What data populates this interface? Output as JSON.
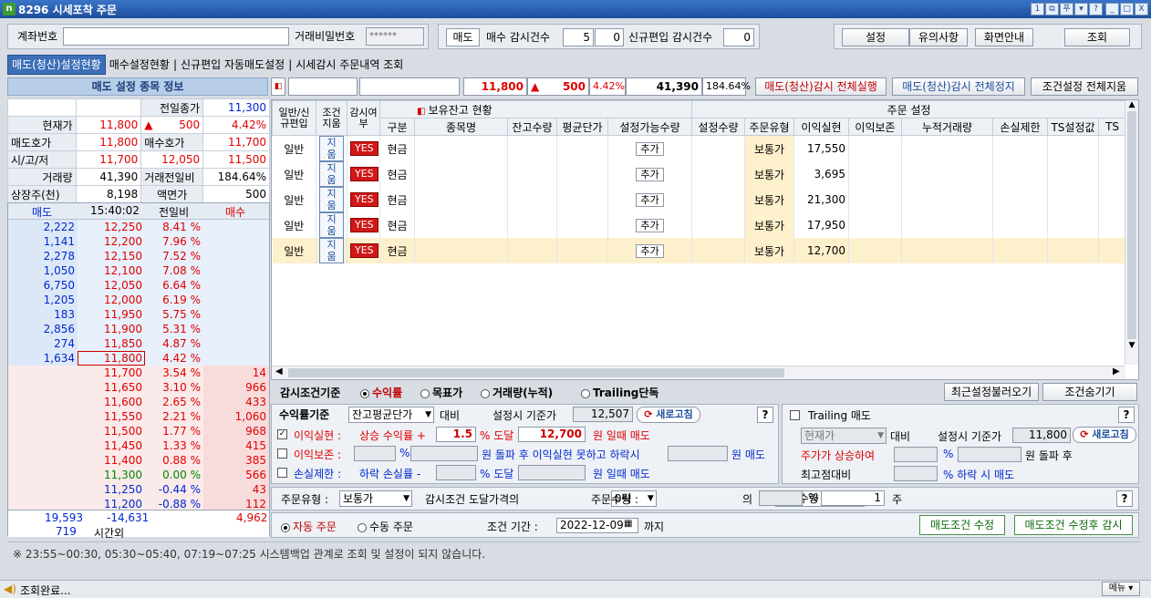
{
  "window": {
    "title": "8296 시세포착 주문",
    "logo": "n",
    "buttons": [
      "1",
      "⧉",
      "푸",
      "▾",
      "?",
      "_",
      "□",
      "X"
    ]
  },
  "top": {
    "account_label": "계좌번호",
    "password_label": "거래비밀번호",
    "password_value": "******",
    "sell_label": "매도",
    "buy_watch_label": "매수 감시건수",
    "buy_watch_a": "5",
    "buy_watch_b": "0",
    "new_watch_label": "신규편입 감시건수",
    "new_watch_val": "0",
    "btn_settings": "설정",
    "btn_notice": "유의사항",
    "btn_guide": "화면안내",
    "btn_query": "조회"
  },
  "tabs": [
    "매도(청산)설정현황",
    "매수설정현황",
    "신규편입 자동매도설정",
    "시세감시 주문내역 조회"
  ],
  "info": {
    "header": "매도 설정 종목 정보",
    "prev_close_label": "전일종가",
    "prev_close": "11,300",
    "cur_label": "현재가",
    "cur": "11,800",
    "chg_sym": "▲",
    "chg": "500",
    "chg_pct": "4.42%",
    "ask_label": "매도호가",
    "ask": "11,800",
    "bid_label": "매수호가",
    "bid": "11,700",
    "ohl_label": "시/고/저",
    "open": "11,700",
    "high": "12,050",
    "low": "11,500",
    "vol_label": "거래량",
    "vol": "41,390",
    "volr_label": "거래전일비",
    "volr": "184.64%",
    "shares_label": "상장주(천)",
    "shares": "8,198",
    "par_label": "액면가",
    "par": "500"
  },
  "hoga": {
    "h_sell": "매도",
    "time": "15:40:02",
    "h_prev": "전일비",
    "h_buy": "매수",
    "asks": [
      [
        "2,222",
        "12,250",
        "8.41 %"
      ],
      [
        "1,141",
        "12,200",
        "7.96 %"
      ],
      [
        "2,278",
        "12,150",
        "7.52 %"
      ],
      [
        "1,050",
        "12,100",
        "7.08 %"
      ],
      [
        "6,750",
        "12,050",
        "6.64 %"
      ],
      [
        "1,205",
        "12,000",
        "6.19 %"
      ],
      [
        "183",
        "11,950",
        "5.75 %"
      ],
      [
        "2,856",
        "11,900",
        "5.31 %"
      ],
      [
        "274",
        "11,850",
        "4.87 %"
      ],
      [
        "1,634",
        "11,800",
        "4.42 %"
      ]
    ],
    "bids": [
      [
        "11,700",
        "3.54 %",
        "14"
      ],
      [
        "11,650",
        "3.10 %",
        "966"
      ],
      [
        "11,600",
        "2.65 %",
        "433"
      ],
      [
        "11,550",
        "2.21 %",
        "1,060"
      ],
      [
        "11,500",
        "1.77 %",
        "968"
      ],
      [
        "11,450",
        "1.33 %",
        "415"
      ],
      [
        "11,400",
        "0.88 %",
        "385"
      ],
      [
        "11,300",
        "0.00 %",
        "566"
      ],
      [
        "11,250",
        "-0.44 %",
        "43"
      ],
      [
        "11,200",
        "-0.88 %",
        "112"
      ]
    ],
    "sum_sell": "19,593",
    "sum_diff": "-14,631",
    "sum_buy": "4,962",
    "after_qty": "719",
    "after_label": "시간외"
  },
  "quote": {
    "price": "11,800",
    "sym": "▲",
    "chg": "500",
    "pct": "4.42%",
    "vol": "41,390",
    "volr": "184.64%",
    "btn_exec": "매도(청산)감시 전체실행",
    "btn_stop": "매도(청산)감시 전체정지",
    "btn_clear": "조건설정 전체지움"
  },
  "grid": {
    "h_type": "일반/신규편입",
    "h_cond": "조건지움",
    "h_watch": "감시여부",
    "h_hold": "보유잔고 현황",
    "h_order": "주문 설정",
    "cols": [
      "구분",
      "종목명",
      "잔고수량",
      "평균단가",
      "설정가능수량",
      "설정수량",
      "주문유형",
      "이익실현",
      "이익보존",
      "누적거래량",
      "손실제한",
      "TS설정값",
      "TS"
    ],
    "rows": [
      [
        "일반",
        "지움",
        "YES",
        "현금",
        "추가",
        "보통가",
        "17,550"
      ],
      [
        "일반",
        "지움",
        "YES",
        "현금",
        "추가",
        "보통가",
        "3,695"
      ],
      [
        "일반",
        "지움",
        "YES",
        "현금",
        "추가",
        "보통가",
        "21,300"
      ],
      [
        "일반",
        "지움",
        "YES",
        "현금",
        "추가",
        "보통가",
        "17,950"
      ],
      [
        "일반",
        "지움",
        "YES",
        "현금",
        "추가",
        "보통가",
        "12,700"
      ]
    ]
  },
  "cond": {
    "label": "감시조건기준",
    "r1": "수익률",
    "r2": "목표가",
    "r3": "거래량(누적)",
    "r4": "Trailing단독",
    "btn_recent": "최근설정불러오기",
    "btn_hide": "조건숨기기"
  },
  "left_panel": {
    "base_label": "수익률기준",
    "base_sel": "잔고평균단가",
    "vs": "대비",
    "set_base_label": "설정시 기준가",
    "set_base": "12,507",
    "refresh": "새로고침",
    "q": "?",
    "p_label": "이익실현 :",
    "p_text1": "상승 수익률 +",
    "p_val": "1.5",
    "p_text2": "% 도달",
    "p_price": "12,700",
    "p_text3": "원 일때 매도",
    "k_label": "이익보존 :",
    "k_pct": "%",
    "k_text1": "원 돌파 후 이익실현 못하고 하락시",
    "k_text2": "원 매도",
    "l_label": "손실제한 :",
    "l_text1": "하락 손실률 -",
    "l_text2": "% 도달",
    "l_text3": "원 일때 매도"
  },
  "right_panel": {
    "title": "Trailing 매도",
    "sel": "현재가",
    "vs": "대비",
    "set_base_label": "설정시 기준가",
    "set_base": "11,800",
    "refresh": "새로고침",
    "q": "?",
    "t1": "주가가 상승하여",
    "pct": "%",
    "t2": "원 돌파 후",
    "t3": "최고점대비",
    "t4": "% 하락 시 매도"
  },
  "order": {
    "type_label": "주문유형 :",
    "type_sel": "보통가",
    "cond_label": "감시조건 도달가격의",
    "tick_sel": "0틱",
    "qty_label": "주문수량 :",
    "qty_sel": "고정수량",
    "of": "의",
    "pct": "%",
    "qty": "1",
    "unit": "주",
    "q": "?"
  },
  "auto": {
    "auto": "자동 주문",
    "manual": "수동 주문",
    "period_label": "조건 기간 :",
    "date": "2022-12-09",
    "until": "까지",
    "btn_mod": "매도조건 수정",
    "btn_mod_watch": "매도조건 수정후 감시"
  },
  "notice": "※ 23:55~00:30, 05:30~05:40, 07:19~07:25 시스템백업 관계로 조회 및 설정이 되지 않습니다.",
  "status": {
    "text": "조회완료...",
    "menu": "메뉴 ▾"
  },
  "colors": {
    "red": "#e00000",
    "blue": "#0028d0",
    "title": "#1d4f9c"
  }
}
